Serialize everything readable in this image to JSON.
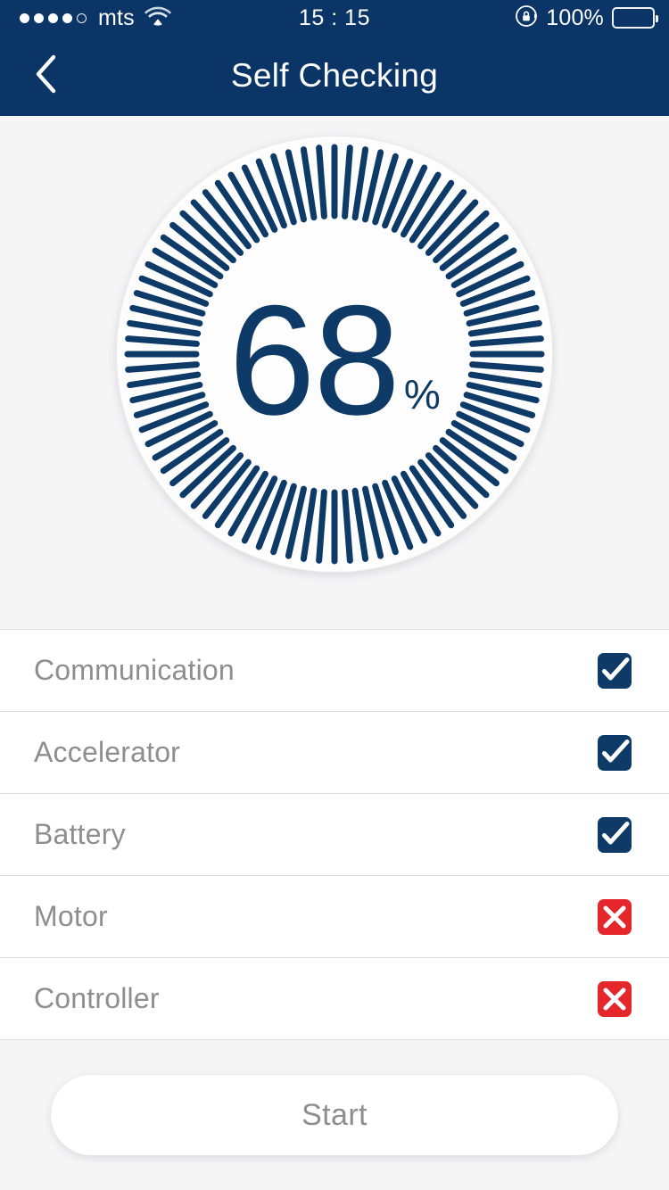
{
  "status_bar": {
    "signal_dots_total": 5,
    "signal_dots_filled": 4,
    "carrier": "mts",
    "wifi_icon": "wifi-icon",
    "time": "15 : 15",
    "rotation_lock_icon": "rotation-lock-icon",
    "battery_percent": "100%",
    "battery_icon": "battery-full-icon",
    "background_color": "#0b3566",
    "text_color": "#ffffff"
  },
  "nav_bar": {
    "back_icon": "chevron-left-icon",
    "title": "Self Checking",
    "background_color": "#0b3566"
  },
  "gauge": {
    "value": "68",
    "unit": "%",
    "tick_count": 84,
    "tick_color": "#0e3a68",
    "value_color": "#0e3a68",
    "panel_background": "#f5f5f6"
  },
  "chart_data": {
    "type": "gauge",
    "title": "Self Checking progress",
    "value": 68,
    "unit": "%",
    "min": 0,
    "max": 100,
    "tick_count": 84,
    "full_circle": true,
    "value_color": "#0e3a68",
    "tick_color": "#0e3a68"
  },
  "check_list": {
    "items": [
      {
        "label": "Communication",
        "status": "pass",
        "status_icon": "check-icon"
      },
      {
        "label": "Accelerator",
        "status": "pass",
        "status_icon": "check-icon"
      },
      {
        "label": "Battery",
        "status": "pass",
        "status_icon": "check-icon"
      },
      {
        "label": "Motor",
        "status": "fail",
        "status_icon": "cross-icon"
      },
      {
        "label": "Controller",
        "status": "fail",
        "status_icon": "cross-icon"
      }
    ],
    "pass_color": "#0e3a68",
    "fail_color": "#e5262b",
    "label_color": "#8e8e90",
    "divider_color": "#dcdcdc"
  },
  "footer": {
    "start_label": "Start",
    "background_color": "#f5f5f6"
  }
}
